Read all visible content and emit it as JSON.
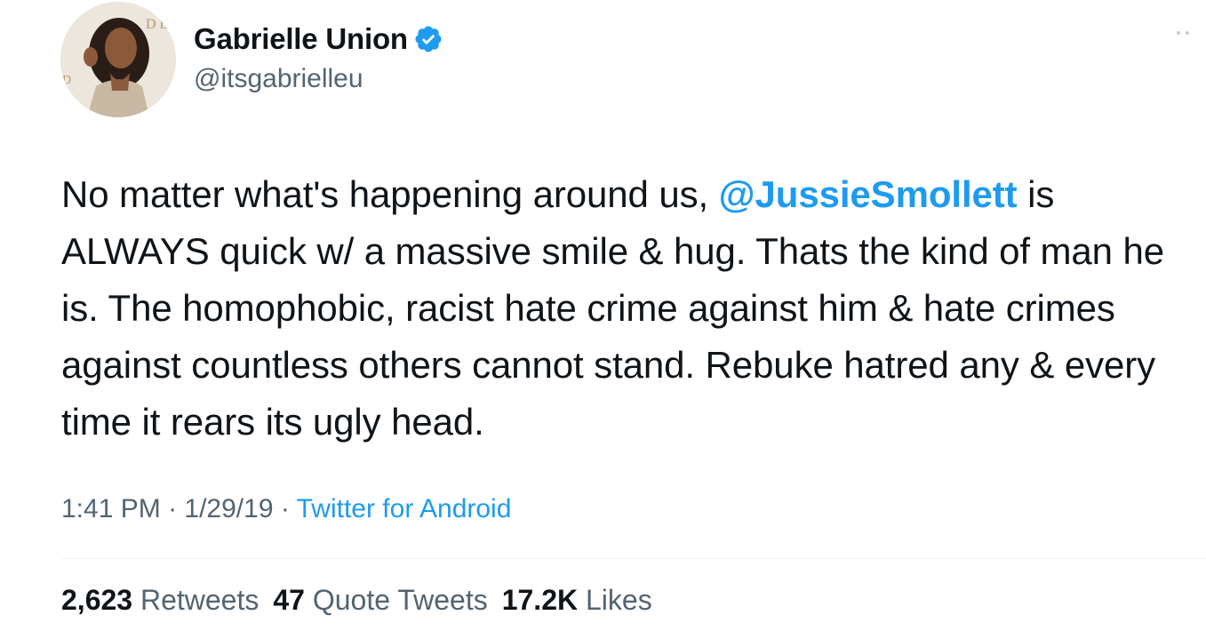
{
  "author": {
    "display_name": "Gabrielle Union",
    "handle": "@itsgabrielleu",
    "verified": true,
    "avatar_alt": "profile photo"
  },
  "icons": {
    "verified": "verified-badge-icon",
    "more": "more-options-icon"
  },
  "tweet": {
    "text_before_mention": "No matter what's happening around us, ",
    "mention": "@JussieSmollett",
    "text_after_mention": " is ALWAYS quick w/ a massive smile & hug. Thats the kind of man he is. The homophobic, racist hate crime against him & hate crimes against countless others cannot stand. Rebuke hatred any & every time it rears its ugly head."
  },
  "meta": {
    "time": "1:41 PM",
    "separator": " · ",
    "date": "1/29/19",
    "source": "Twitter for Android"
  },
  "stats": {
    "retweets_count": "2,623",
    "retweets_label": "Retweets",
    "quotes_count": "47",
    "quotes_label": "Quote Tweets",
    "likes_count": "17.2K",
    "likes_label": "Likes"
  },
  "colors": {
    "accent": "#1d9bf0",
    "text_primary": "#0f1419",
    "text_secondary": "#536471"
  }
}
